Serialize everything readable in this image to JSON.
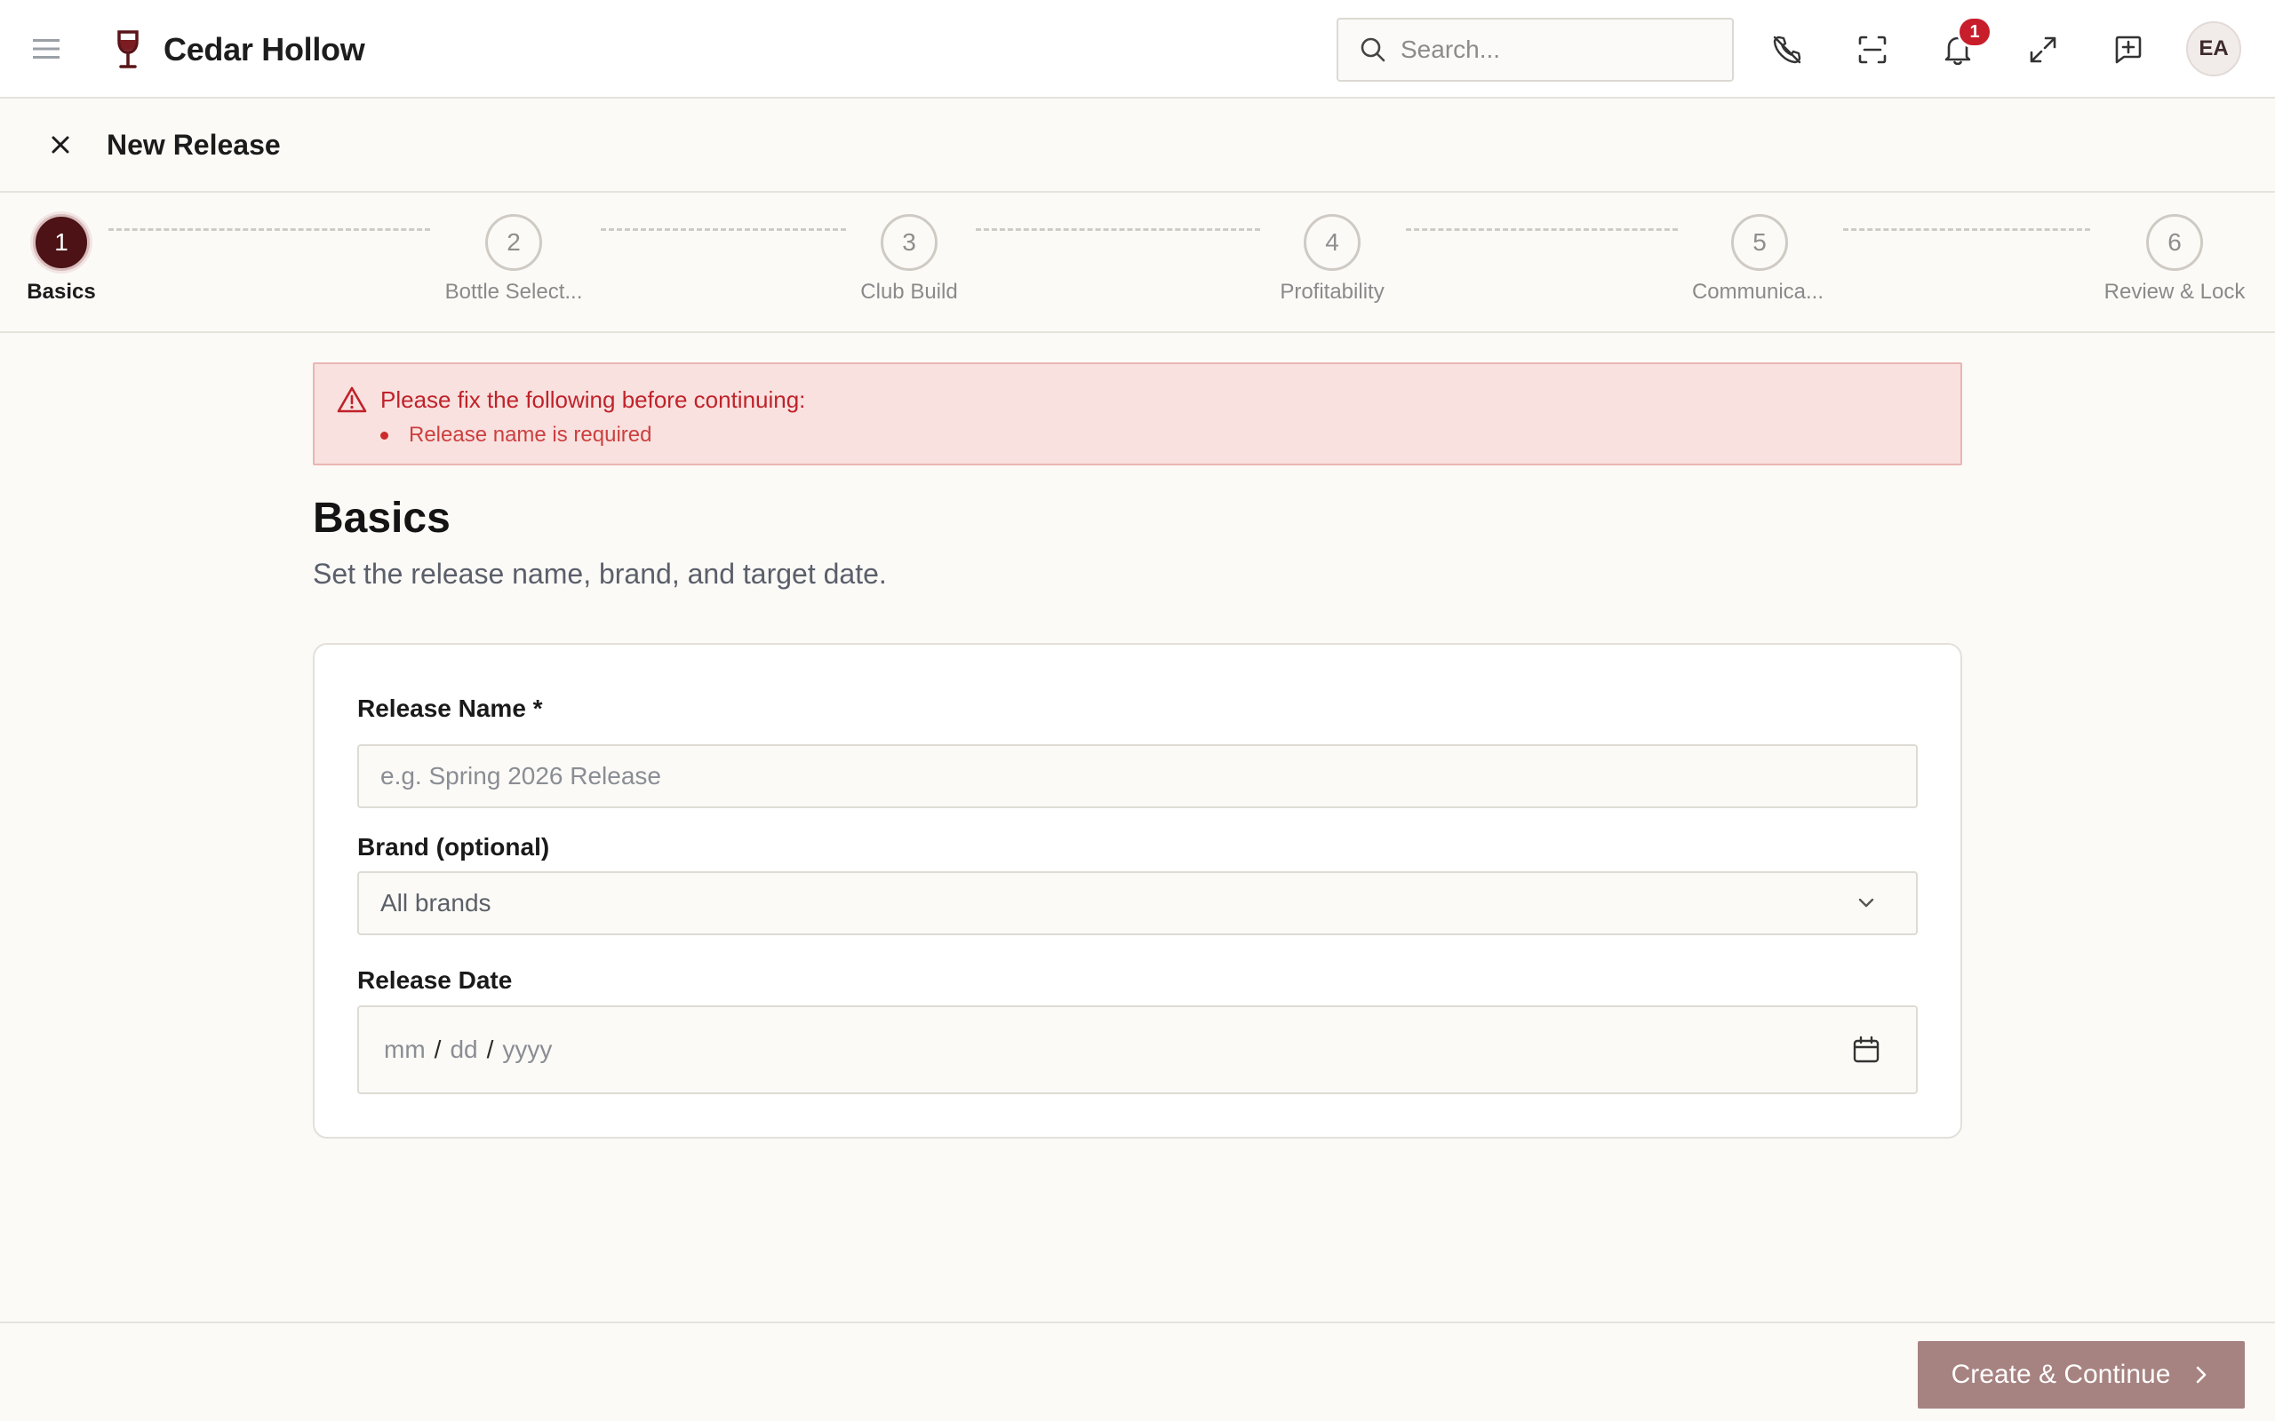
{
  "header": {
    "brand": "Cedar Hollow",
    "search_placeholder": "Search...",
    "notification_count": "1",
    "avatar_initials": "EA"
  },
  "page": {
    "title": "New Release"
  },
  "stepper": {
    "steps": [
      {
        "number": "1",
        "label": "Basics",
        "active": true
      },
      {
        "number": "2",
        "label": "Bottle Select...",
        "active": false
      },
      {
        "number": "3",
        "label": "Club Build",
        "active": false
      },
      {
        "number": "4",
        "label": "Profitability",
        "active": false
      },
      {
        "number": "5",
        "label": "Communica...",
        "active": false
      },
      {
        "number": "6",
        "label": "Review & Lock",
        "active": false
      }
    ]
  },
  "alert": {
    "title": "Please fix the following before continuing:",
    "items": [
      "Release name is required"
    ]
  },
  "section": {
    "title": "Basics",
    "subtitle": "Set the release name, brand, and target date."
  },
  "form": {
    "release_name": {
      "label": "Release Name *",
      "placeholder": "e.g. Spring 2026 Release",
      "value": ""
    },
    "brand": {
      "label": "Brand (optional)",
      "value": "All brands"
    },
    "release_date": {
      "label": "Release Date",
      "mm": "mm",
      "dd": "dd",
      "yyyy": "yyyy",
      "sep": "/"
    }
  },
  "footer": {
    "primary_label": "Create & Continue"
  },
  "colors": {
    "accent": "#4c1215",
    "primary_button": "#a68381",
    "error_text": "#c0222a",
    "error_bg": "#f8e1df",
    "badge": "#c81e2b"
  },
  "icons": {
    "menu": "hamburger-menu-icon",
    "logo": "wine-glass-icon",
    "search": "search-icon",
    "top_1": "phone-off-icon",
    "top_2": "scan-icon",
    "top_3": "bell-icon",
    "top_4": "expand-icon",
    "top_5": "message-plus-icon",
    "close": "close-icon",
    "alert": "warning-triangle-icon",
    "select": "chevron-down-icon",
    "date": "calendar-icon",
    "button": "chevron-right-icon"
  }
}
